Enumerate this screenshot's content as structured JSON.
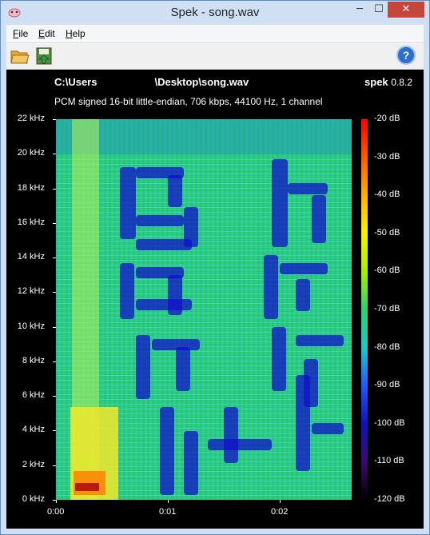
{
  "window": {
    "title": "Spek - song.wav",
    "min_glyph": "─",
    "max_glyph": "☐",
    "close_glyph": "✕"
  },
  "menu": {
    "file": {
      "accel": "F",
      "rest": "ile"
    },
    "edit": {
      "accel": "E",
      "rest": "dit"
    },
    "help": {
      "accel": "H",
      "rest": "elp"
    }
  },
  "toolbar": {
    "open_icon": "folder-open-icon",
    "save_icon": "save-icon",
    "help_icon": "help-icon",
    "help_glyph": "?"
  },
  "file_path_left": "C:\\Users",
  "file_path_right": "\\Desktop\\song.wav",
  "brand_name": "spek",
  "brand_version": "0.8.2",
  "audio_info": "PCM signed 16-bit little-endian, 706 kbps, 44100 Hz, 1 channel",
  "freq_axis": [
    "22 kHz",
    "20 kHz",
    "18 kHz",
    "16 kHz",
    "14 kHz",
    "12 kHz",
    "10 kHz",
    "8 kHz",
    "6 kHz",
    "4 kHz",
    "2 kHz",
    "0 kHz"
  ],
  "time_axis": [
    "0:00",
    "0:01",
    "0:02"
  ],
  "db_axis": [
    "-20 dB",
    "-30 dB",
    "-40 dB",
    "-50 dB",
    "-60 dB",
    "-70 dB",
    "-80 dB",
    "-90 dB",
    "-100 dB",
    "-110 dB",
    "-120 dB"
  ],
  "colors": {
    "background": "#000000",
    "plot_base": "#2ed16a",
    "close_button": "#c7463c"
  }
}
